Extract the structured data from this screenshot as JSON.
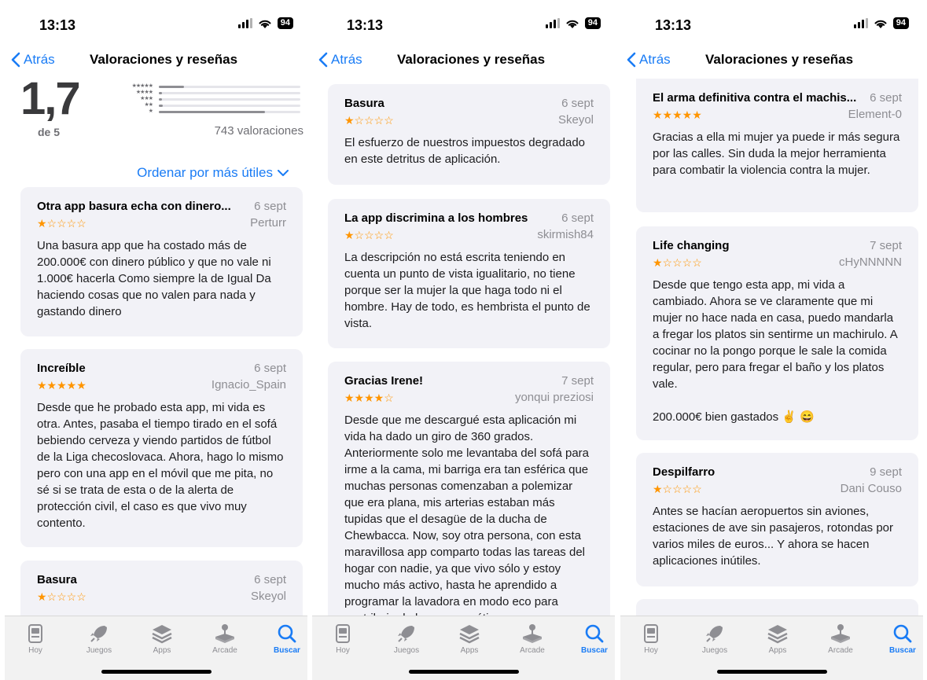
{
  "status": {
    "time": "13:13",
    "battery": "94"
  },
  "nav": {
    "back_label": "Atrás",
    "title": "Valoraciones y reseñas"
  },
  "summary": {
    "rating": "1,7",
    "out_of": "de 5",
    "count": "743 valoraciones",
    "histogram": [
      {
        "stars": "★★★★★",
        "fraction": 0.18
      },
      {
        "stars": "★★★★",
        "fraction": 0.02
      },
      {
        "stars": "★★★",
        "fraction": 0.02
      },
      {
        "stars": "★★",
        "fraction": 0.03
      },
      {
        "stars": "★",
        "fraction": 0.75
      }
    ]
  },
  "sort_label": "Ordenar por más útiles",
  "colors": {
    "accent": "#1a7cf5",
    "star": "#ff9500",
    "card": "#f2f2f7"
  },
  "tabs": [
    {
      "label": "Hoy",
      "icon": "today-icon"
    },
    {
      "label": "Juegos",
      "icon": "rocket-icon"
    },
    {
      "label": "Apps",
      "icon": "stack-icon"
    },
    {
      "label": "Arcade",
      "icon": "joystick-icon"
    },
    {
      "label": "Buscar",
      "icon": "search-icon",
      "active": true
    }
  ],
  "screens": [
    {
      "reviews": [
        {
          "title": "Otra app basura echa con dinero...",
          "date": "6 sept",
          "stars": "★☆☆☆☆",
          "rating": 1,
          "author": "Perturr",
          "body": [
            "Una basura app que ha costado más de 200.000€ con dinero público y que no vale ni 1.000€ hacerla Como siempre la de Igual Da haciendo cosas que no valen para nada y gastando dinero"
          ]
        },
        {
          "title": "Increíble",
          "date": "6 sept",
          "stars": "★★★★★",
          "rating": 5,
          "author": "Ignacio_Spain",
          "body": [
            "Desde que he probado esta app, mi vida es otra. Antes, pasaba el tiempo tirado en el sofá bebiendo cerveza y viendo partidos de fútbol de la Liga checoslovaca. Ahora, hago lo mismo pero con una app en el móvil que me pita, no sé si se trata de esta o de la alerta de protección civil, el caso es que vivo muy contento."
          ]
        },
        {
          "title": "Basura",
          "date": "6 sept",
          "stars": "★☆☆☆☆",
          "rating": 1,
          "author": "Skeyol",
          "body": []
        }
      ]
    },
    {
      "reviews": [
        {
          "title": "Basura",
          "date": "6 sept",
          "stars": "★☆☆☆☆",
          "rating": 1,
          "author": "Skeyol",
          "body": [
            "El esfuerzo de nuestros impuestos degradado en este detritus de aplicación."
          ]
        },
        {
          "title": "La app discrimina a los hombres",
          "date": "6 sept",
          "stars": "★☆☆☆☆",
          "rating": 1,
          "author": "skirmish84",
          "body": [
            "La descripción no está escrita teniendo en cuenta un punto de vista igualitario, no tiene porque ser la mujer la que haga todo ni el hombre. Hay de todo, es hembrista el punto de vista."
          ]
        },
        {
          "title": "Gracias Irene!",
          "date": "7 sept",
          "stars": "★★★★☆",
          "rating": 4,
          "author": "yonqui preziosi",
          "body": [
            "Desde que me descargué esta aplicación mi vida ha dado un giro de 360 grados. Anteriormente solo me levantaba del sofá para irme a la cama, mi barriga era tan esférica que muchas personas comenzaban a polemizar que era plana, mis arterias estaban más tupidas que el desagüe de la ducha de Chewbacca. Now, soy otra persona, con esta maravillosa app comparto todas las tareas del hogar con nadie, ya que vivo sólo y estoy mucho más activo, hasta he aprendido a programar la lavadora en modo eco para contribuir al ahorro energético y"
          ]
        }
      ]
    },
    {
      "reviews": [
        {
          "title": "El arma definitiva contra el machis...",
          "date": "6 sept",
          "stars": "★★★★★",
          "rating": 5,
          "author": "Element-0",
          "body": [
            "Gracias a ella mi mujer ya puede ir más segura por las calles. Sin duda la mejor herramienta para combatir la violencia contra la mujer."
          ]
        },
        {
          "title": "Life changing",
          "date": "7 sept",
          "stars": "★☆☆☆☆",
          "rating": 1,
          "author": "cHyNNNNN",
          "body": [
            "Desde que tengo esta app, mi vida a cambiado. Ahora se ve claramente que mi mujer no hace nada en casa, puedo mandarla a fregar los platos sin sentirme un machirulo. A cocinar no la pongo porque le sale la comida regular, pero para fregar el baño y los platos vale.",
            "200.000€ bien gastados ✌️ 😄"
          ]
        },
        {
          "title": "Despilfarro",
          "date": "9 sept",
          "stars": "★☆☆☆☆",
          "rating": 1,
          "author": "Dani Couso",
          "body": [
            "Antes se hacían aeropuertos sin aviones, estaciones de ave sin pasajeros, rotondas por varios miles de euros... Y ahora se hacen aplicaciones inútiles."
          ]
        },
        {
          "title": "",
          "date": "",
          "stars": "",
          "rating": 0,
          "author": "",
          "body": []
        }
      ]
    }
  ]
}
